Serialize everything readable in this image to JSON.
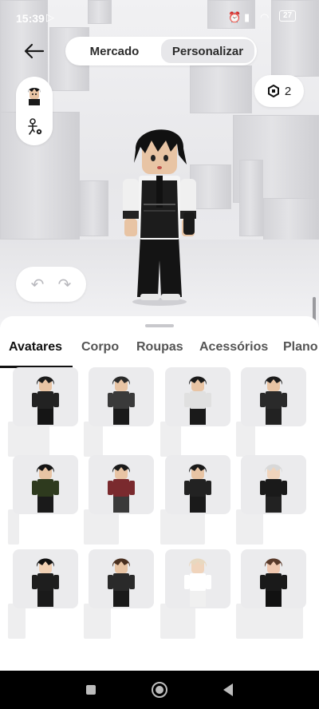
{
  "status_bar": {
    "time": "15:39",
    "left_icon": "play-store-icon",
    "right_icons": [
      "alarm-off-icon",
      "signal-icon",
      "wifi-icon",
      "battery-icon"
    ],
    "battery": "27"
  },
  "top_nav": {
    "tabs": [
      {
        "label": "Mercado",
        "active": false
      },
      {
        "label": "Personalizar",
        "active": true
      }
    ]
  },
  "robux": {
    "icon": "robux-icon",
    "count": "2"
  },
  "side_controls": [
    "avatar-thumbnail-icon",
    "avatar-settings-icon"
  ],
  "history": [
    "undo-icon",
    "redo-icon"
  ],
  "sheet": {
    "tabs": [
      {
        "label": "Avatares",
        "active": true
      },
      {
        "label": "Corpo",
        "active": false
      },
      {
        "label": "Roupas",
        "active": false
      },
      {
        "label": "Acessórios",
        "active": false
      },
      {
        "label": "Plano",
        "active": false
      }
    ],
    "items": [
      {
        "hair": "#1a1a1a",
        "top": "#222222",
        "bottom": "#151515",
        "skin": "#e8c4a4"
      },
      {
        "hair": "#2a2a2a",
        "top": "#3a3a3a",
        "bottom": "#1a1a1a",
        "skin": "#e8c4a4"
      },
      {
        "hair": "#1b1b1b",
        "top": "#e0e0e0",
        "bottom": "#1a1a1a",
        "skin": "#e8c4a4"
      },
      {
        "hair": "#1b1b1b",
        "top": "#2a2a2a",
        "bottom": "#222222",
        "skin": "#e8c4a4"
      },
      {
        "hair": "#151515",
        "top": "#2e3a1e",
        "bottom": "#1a1a1a",
        "skin": "#e8c4a4"
      },
      {
        "hair": "#1a1a1a",
        "top": "#7a2a2e",
        "bottom": "#3a3a3a",
        "skin": "#e8c4a4"
      },
      {
        "hair": "#1a1a1a",
        "top": "#222222",
        "bottom": "#1a1a1a",
        "skin": "#e8c4a4"
      },
      {
        "hair": "#d8d8d8",
        "top": "#1a1a1a",
        "bottom": "#222222",
        "skin": "#f0d4bc"
      },
      {
        "hair": "#111111",
        "top": "#1e1e1e",
        "bottom": "#1a1a1a",
        "skin": "#f0d0b4"
      },
      {
        "hair": "#4a3020",
        "top": "#2a2a2a",
        "bottom": "#1a1a1a",
        "skin": "#e8c4a4"
      },
      {
        "hair": "#e8d8c0",
        "top": "#ffffff",
        "bottom": "#f0f0f0",
        "skin": "#f0d4bc"
      },
      {
        "hair": "#5a3a2a",
        "top": "#1a1a1a",
        "bottom": "#111111",
        "skin": "#f0c8b0"
      }
    ]
  },
  "nav_bar": {
    "buttons": [
      "recents-icon",
      "home-icon",
      "back-icon"
    ]
  }
}
